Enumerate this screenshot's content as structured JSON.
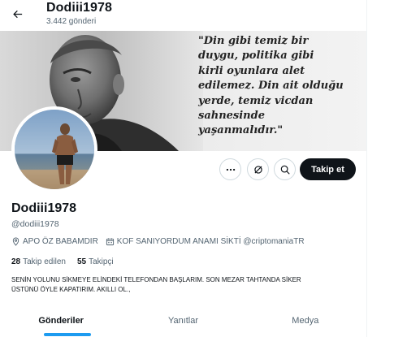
{
  "header": {
    "name": "Dodiii1978",
    "posts_count": "3.442 gönderi"
  },
  "banner": {
    "quote_lines": [
      "\"Din gibi temiz bir",
      "duygu, politika gibi",
      "kirli oyunlara alet",
      "edilemez. Din ait olduğu",
      "yerde, temiz vicdan",
      "sahnesinde",
      "yaşanmalıdır.\""
    ]
  },
  "actions": {
    "follow_label": "Takip et"
  },
  "profile": {
    "display_name": "Dodiii1978",
    "handle": "@dodiii1978",
    "location": "APO ÖZ BABAMDIR",
    "website": "KOF SANIYORDUM ANAMI SİKTİ @criptomaniaTR",
    "following_count": "28",
    "following_label": "Takip edilen",
    "followers_count": "55",
    "followers_label": "Takipçi",
    "bio_line1": "SENİN YOLUNU SİKMEYE ELİNDEKİ TELEFONDAN BAŞLARIM. SON MEZAR TAHTANDA SİKER",
    "bio_line2": "ÜSTÜNÜ ÖYLE KAPATIRIM. AKILLI OL.,"
  },
  "tabs": [
    {
      "label": "Gönderiler",
      "active": true
    },
    {
      "label": "Yanıtlar",
      "active": false
    },
    {
      "label": "Medya",
      "active": false
    }
  ],
  "colors": {
    "accent": "#1d9bf0",
    "text_primary": "#0f1419",
    "text_secondary": "#536471",
    "follow_button_bg": "#0f1419"
  },
  "icons": {
    "back": "arrow-left-icon",
    "more": "more-dots-icon",
    "grok": "grok-icon",
    "search": "search-icon",
    "location": "location-pin-icon",
    "website": "calendar-icon"
  }
}
